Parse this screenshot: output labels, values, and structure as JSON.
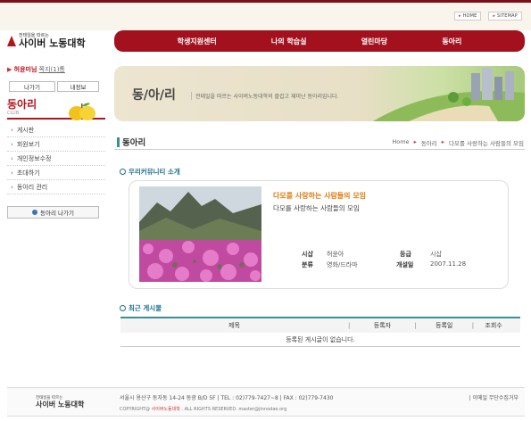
{
  "toplinks": {
    "home": "HOME",
    "sitemap": "SITEMAP"
  },
  "logo": {
    "sub": "전태일을 따르는",
    "main": "사이버 노동대학"
  },
  "nav": [
    "학생지원센터",
    "나의 학습실",
    "열린마당",
    "동아리"
  ],
  "welcome": {
    "name": "허윤미님",
    "message": "쪽지(1)통"
  },
  "left_buttons": {
    "logout": "나가기",
    "myinfo": "내정보"
  },
  "club": {
    "title": "동아리",
    "sub": "CLUB"
  },
  "left_menu": [
    "게시판",
    "회원보기",
    "개인정보수정",
    "초대하기",
    "동아리 관리"
  ],
  "exit_button": "동아리 나가기",
  "banner": {
    "title": "동/아/리",
    "desc": "전태일을 따르는 사이버노동대학의 즐겁고 재미난 동아리입니다."
  },
  "section_title": "동아리",
  "breadcrumb": [
    "Home",
    "동아리",
    "다모를 사랑하는 사람들의 모임"
  ],
  "intro_title": "우리커뮤니티 소개",
  "community": {
    "name": "다모를 사랑하는 사람들의 모임",
    "desc": "다모를 사랑하는 사람들의 모임",
    "owner_label": "시삽",
    "owner": "허윤아",
    "grade_label": "등급",
    "grade": "시삽",
    "category_label": "분류",
    "category": "영화/드라마",
    "created_label": "개설일",
    "created": "2007.11.28"
  },
  "recent_title": "최근 게시물",
  "table": {
    "headers": [
      "제목",
      "등록자",
      "등록일",
      "조회수"
    ],
    "empty": "등록된 게시글이 없습니다."
  },
  "footer": {
    "logo_sub": "전태일을 따르는",
    "logo_main": "사이버 노동대학",
    "address": "서울시 용산구 동자동 14-24 동광 B/D 5F  |  TEL : 02)779-7427~8  |  FAX : 02)779-7430",
    "copy_prefix": "COPYRIGHT@",
    "copy_name": "사이버노동대학",
    "copy_suffix": ". ALL RIGHTS RESERVED.  master@jinnodae.org",
    "right": "이메일 무단수집거부"
  }
}
